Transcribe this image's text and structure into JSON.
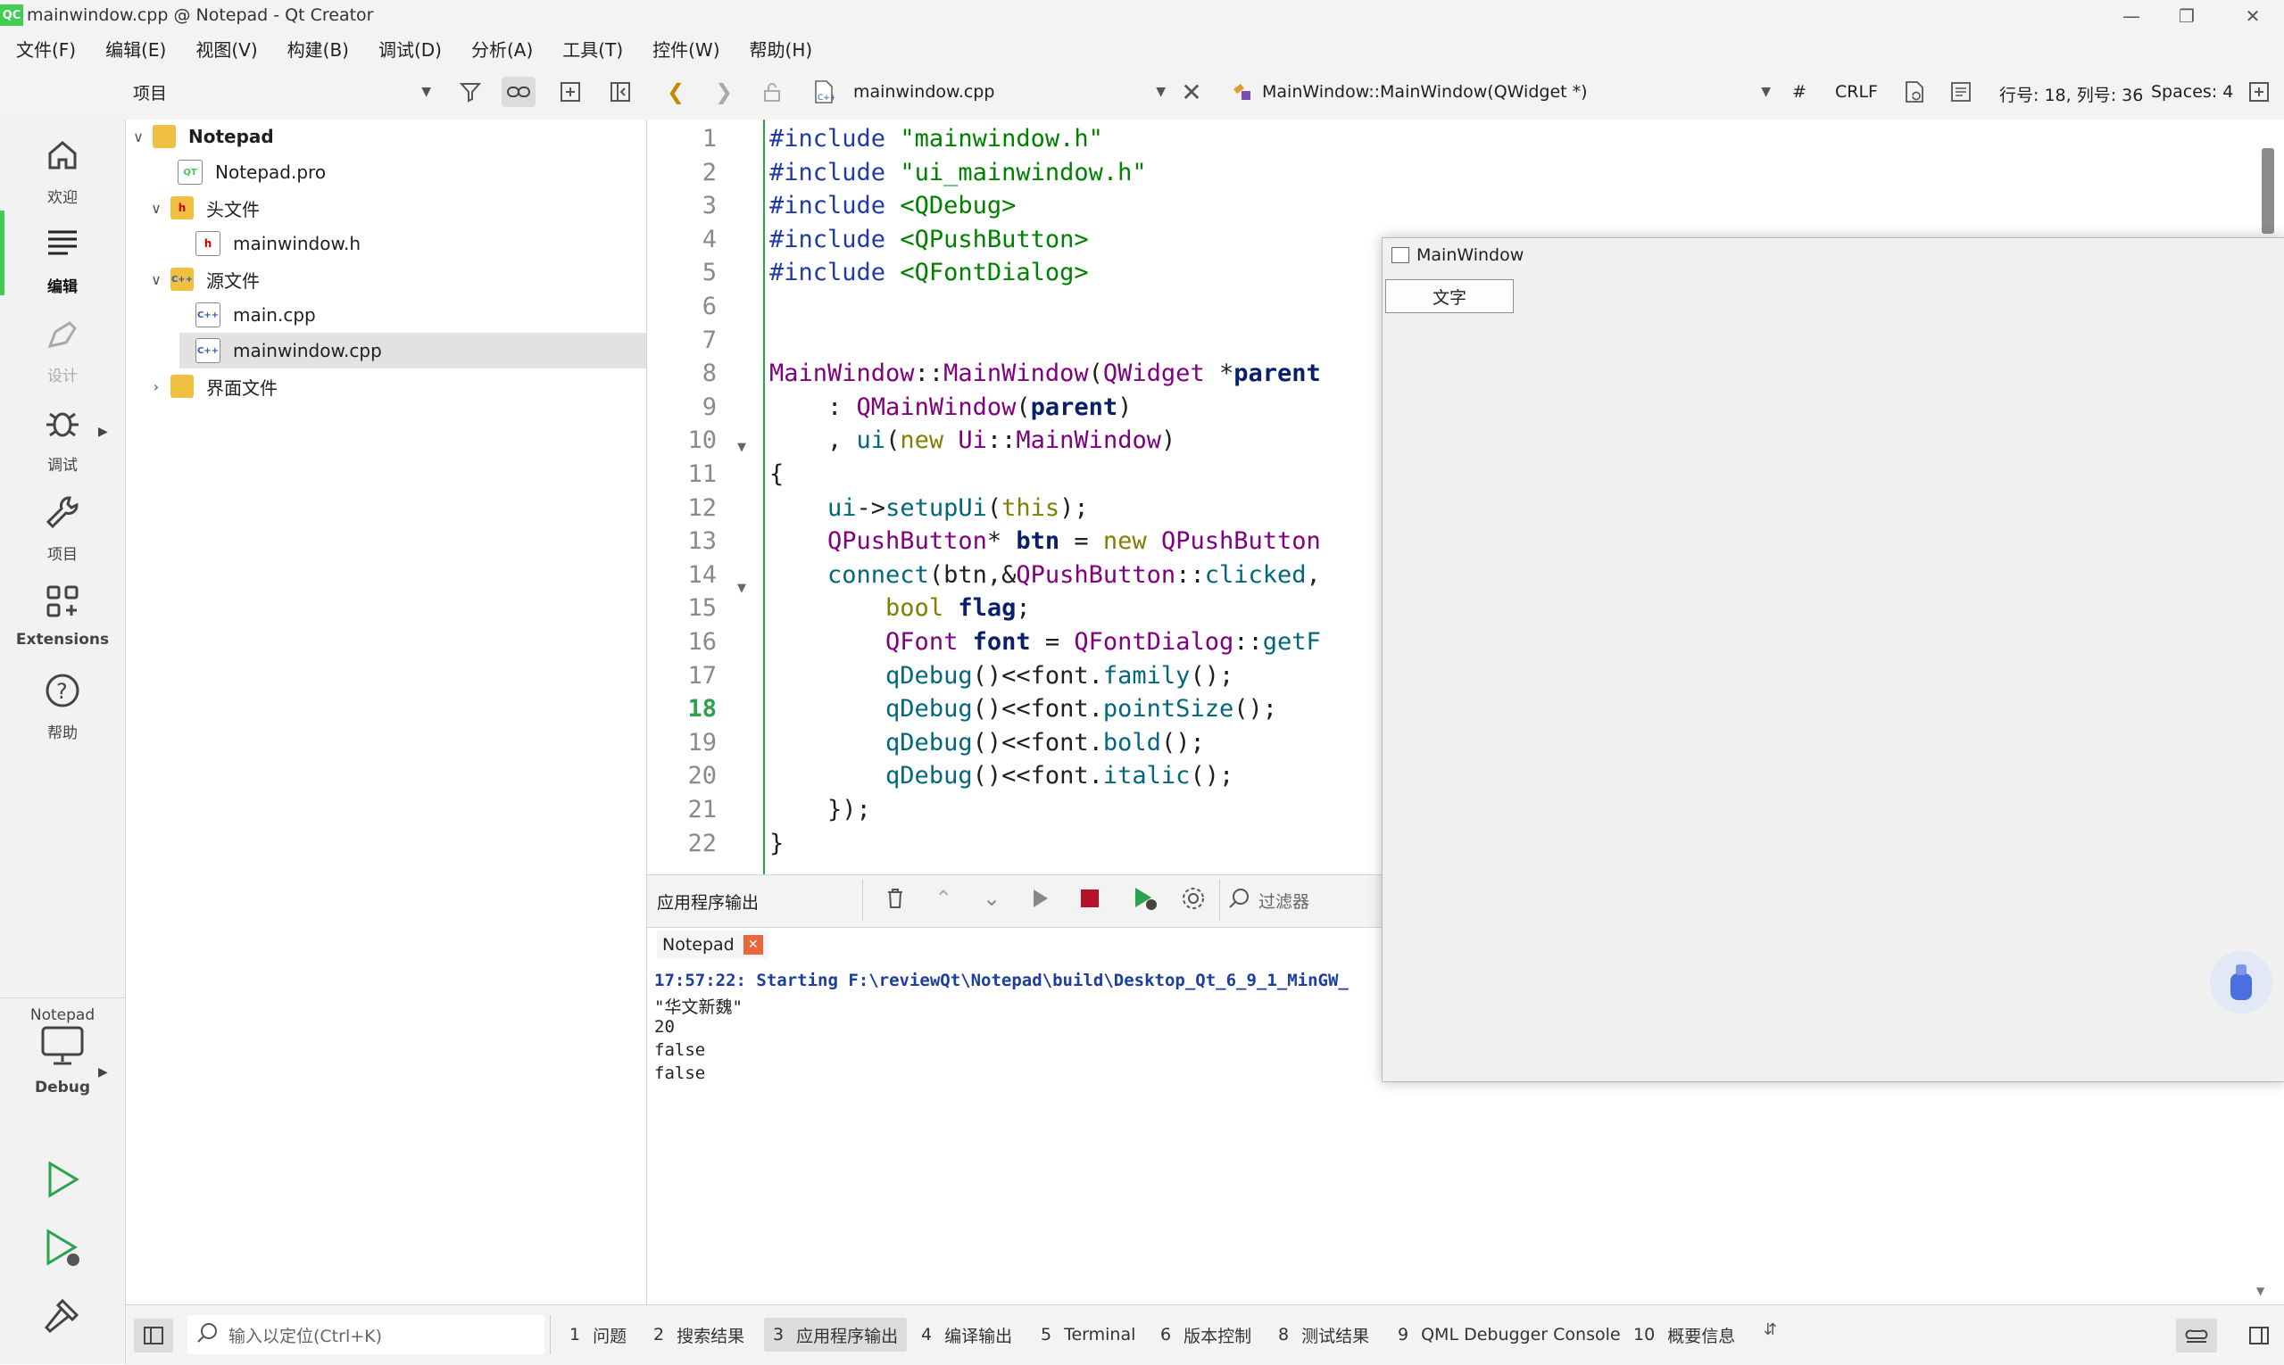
{
  "window": {
    "title": "mainwindow.cpp @ Notepad - Qt Creator",
    "logo": "QC"
  },
  "menu": [
    "文件(F)",
    "编辑(E)",
    "视图(V)",
    "构建(B)",
    "调试(D)",
    "分析(A)",
    "工具(T)",
    "控件(W)",
    "帮助(H)"
  ],
  "project_pane": {
    "selector_label": "项目"
  },
  "editor_toolbar": {
    "file_name": "mainwindow.cpp",
    "symbol": "MainWindow::MainWindow(QWidget *)",
    "hash": "#",
    "line_ending": "CRLF",
    "cursor_pos": "行号: 18, 列号: 36",
    "indent": "Spaces: 4"
  },
  "modes": [
    {
      "label": "欢迎",
      "icon": "home-icon"
    },
    {
      "label": "编辑",
      "icon": "edit-icon"
    },
    {
      "label": "设计",
      "icon": "design-pen-icon"
    },
    {
      "label": "调试",
      "icon": "bug-icon"
    },
    {
      "label": "项目",
      "icon": "wrench-icon"
    },
    {
      "label": "Extensions",
      "icon": "extensions-icon"
    },
    {
      "label": "帮助",
      "icon": "help-icon"
    }
  ],
  "kit": {
    "project": "Notepad",
    "config": "Debug"
  },
  "tree": {
    "root": "Notepad",
    "pro": "Notepad.pro",
    "headers_folder": "头文件",
    "header_file": "mainwindow.h",
    "sources_folder": "源文件",
    "source_main": "main.cpp",
    "source_mainwindow": "mainwindow.cpp",
    "forms_folder": "界面文件"
  },
  "code": {
    "current_line": 18,
    "lines": [
      "#include \"mainwindow.h\"",
      "#include \"ui_mainwindow.h\"",
      "#include <QDebug>",
      "#include <QPushButton>",
      "#include <QFontDialog>",
      "",
      "",
      "MainWindow::MainWindow(QWidget *parent",
      "    : QMainWindow(parent)",
      "    , ui(new Ui::MainWindow)",
      "{",
      "    ui->setupUi(this);",
      "    QPushButton* btn = new QPushButton",
      "    connect(btn,&QPushButton::clicked,",
      "        bool flag;",
      "        QFont font = QFontDialog::getF",
      "        qDebug()<<font.family();",
      "        qDebug()<<font.pointSize();",
      "        qDebug()<<font.bold();",
      "        qDebug()<<font.italic();",
      "    });",
      "}"
    ]
  },
  "output": {
    "panel_title": "应用程序输出",
    "filter_placeholder": "过滤器",
    "tab_name": "Notepad",
    "lines": [
      "17:57:22: Starting F:\\reviewQt\\Notepad\\build\\Desktop_Qt_6_9_1_MinGW_",
      "\"华文新魏\"",
      "20",
      "false",
      "false"
    ]
  },
  "app_window": {
    "title": "MainWindow",
    "button_label": "文字"
  },
  "statusbar": {
    "locator_placeholder": "输入以定位(Ctrl+K)",
    "tabs": [
      {
        "num": "1",
        "label": "问题"
      },
      {
        "num": "2",
        "label": "搜索结果"
      },
      {
        "num": "3",
        "label": "应用程序输出"
      },
      {
        "num": "4",
        "label": "编译输出"
      },
      {
        "num": "5",
        "label": "Terminal"
      },
      {
        "num": "6",
        "label": "版本控制"
      },
      {
        "num": "8",
        "label": "测试结果"
      },
      {
        "num": "9",
        "label": "QML Debugger Console"
      },
      {
        "num": "10",
        "label": "概要信息"
      }
    ],
    "active_tab_index": 2
  },
  "colors": {
    "accent_green": "#41cd52",
    "stop_red": "#b5122a",
    "keyword_olive": "#808000",
    "type_purple": "#800080",
    "string_green": "#008000",
    "number_blue": "#1e4fc9"
  }
}
